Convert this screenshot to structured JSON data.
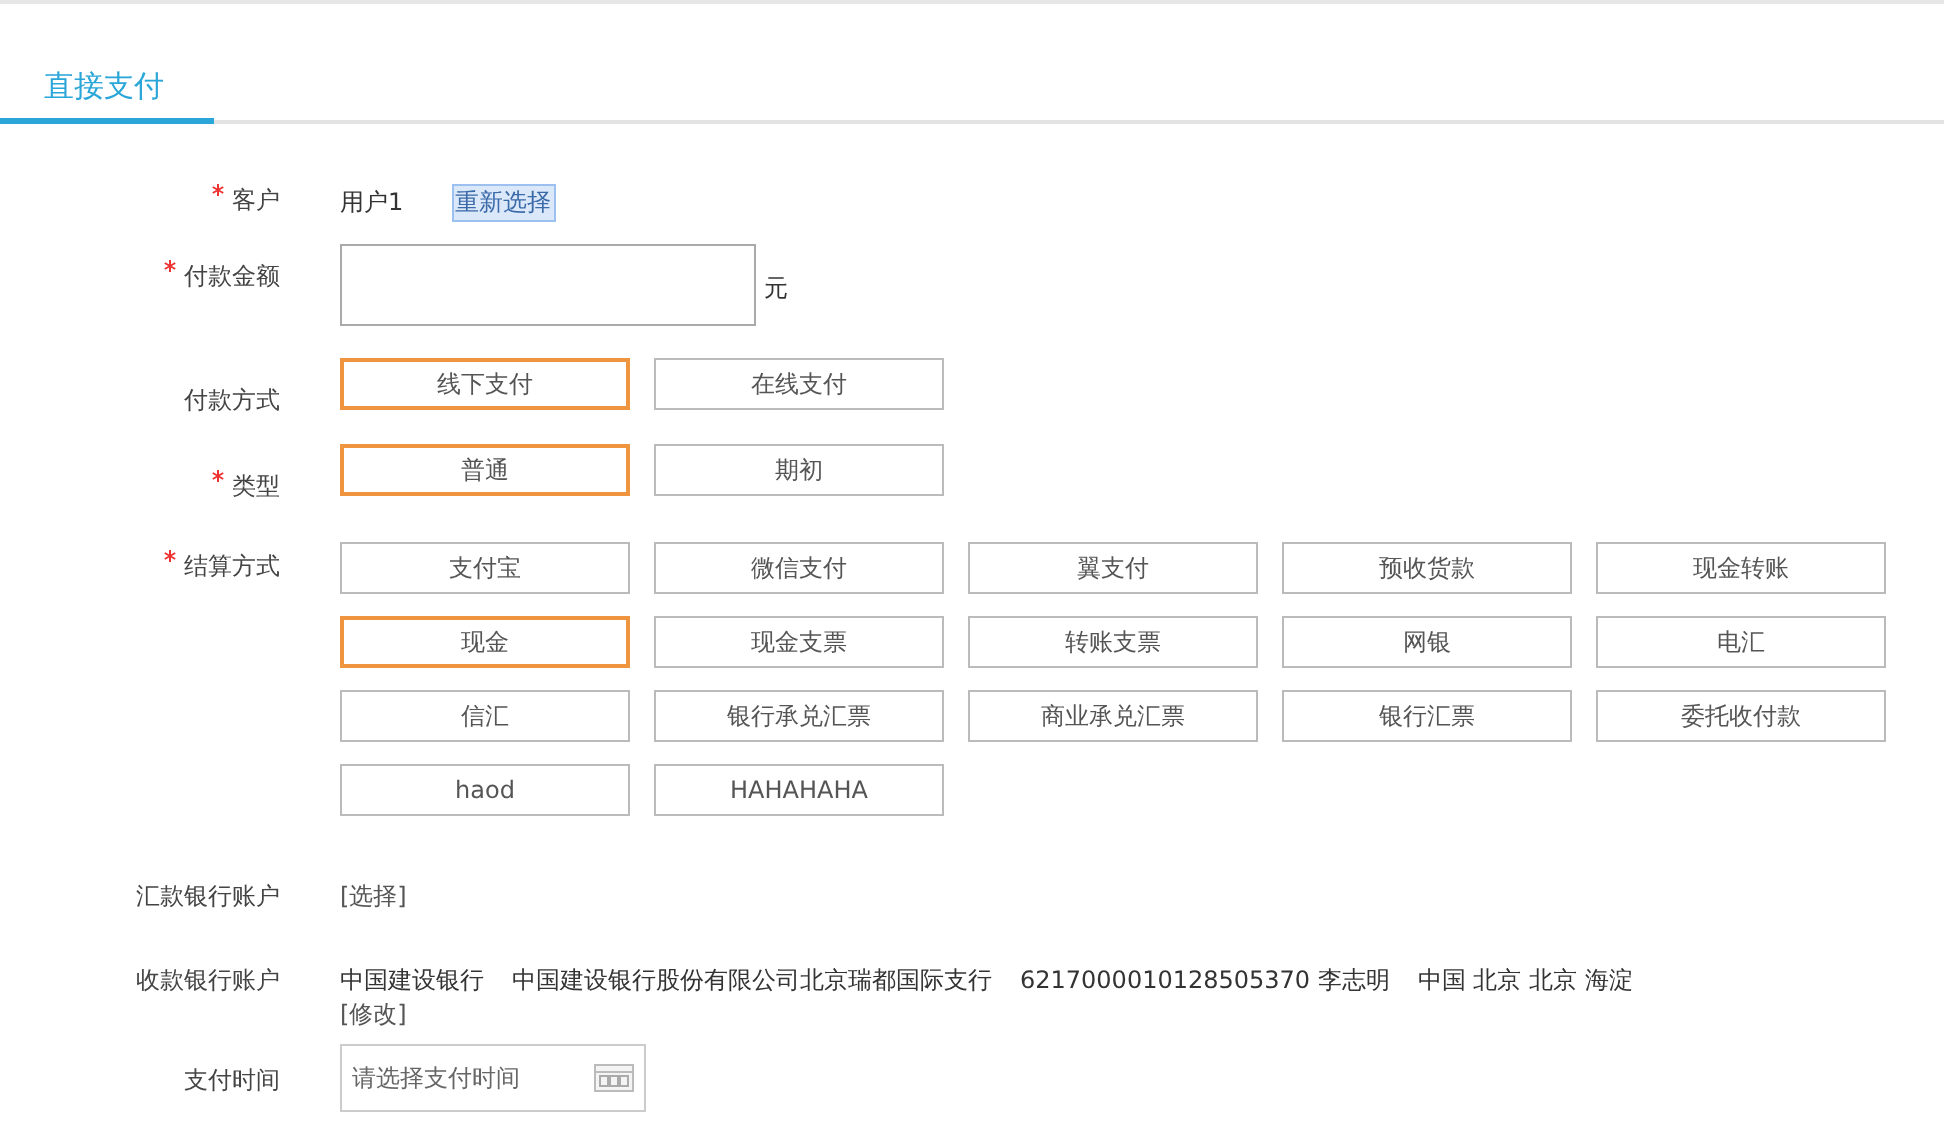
{
  "tabs": [
    {
      "label": "直接支付",
      "selected": true
    }
  ],
  "customer": {
    "label": "客户",
    "required": true,
    "value": "用户1",
    "link": "重新选择"
  },
  "amount": {
    "label": "付款金额",
    "required": true,
    "unit": "元"
  },
  "payment_method": {
    "label": "付款方式",
    "required": false,
    "options": [
      {
        "label": "线下支付",
        "selected": true
      },
      {
        "label": "在线支付",
        "selected": false
      }
    ]
  },
  "type": {
    "label": "类型",
    "required": true,
    "options": [
      {
        "label": "普通",
        "selected": true
      },
      {
        "label": "期初",
        "selected": false
      }
    ]
  },
  "settlement": {
    "label": "结算方式",
    "required": true,
    "options": [
      {
        "label": "支付宝",
        "selected": false
      },
      {
        "label": "微信支付",
        "selected": false
      },
      {
        "label": "翼支付",
        "selected": false
      },
      {
        "label": "预收货款",
        "selected": false
      },
      {
        "label": "现金转账",
        "selected": false
      },
      {
        "label": "现金",
        "selected": true
      },
      {
        "label": "现金支票",
        "selected": false
      },
      {
        "label": "转账支票",
        "selected": false
      },
      {
        "label": "网银",
        "selected": false
      },
      {
        "label": "电汇",
        "selected": false
      },
      {
        "label": "信汇",
        "selected": false
      },
      {
        "label": "银行承兑汇票",
        "selected": false
      },
      {
        "label": "商业承兑汇票",
        "selected": false
      },
      {
        "label": "银行汇票",
        "selected": false
      },
      {
        "label": "委托收付款",
        "selected": false
      },
      {
        "label": "haod",
        "selected": false
      },
      {
        "label": "HAHAHAHA",
        "selected": false
      }
    ]
  },
  "remit_account": {
    "label": "汇款银行账户",
    "link": "[选择]"
  },
  "receive_account": {
    "label": "收款银行账户",
    "parts": [
      "中国建设银行",
      "中国建设银行股份有限公司北京瑞都国际支行",
      "6217000010128505370 李志明",
      "中国 北京 北京 海淀"
    ],
    "link": "[修改]"
  },
  "pay_time": {
    "label": "支付时间",
    "placeholder": "请选择支付时间"
  }
}
